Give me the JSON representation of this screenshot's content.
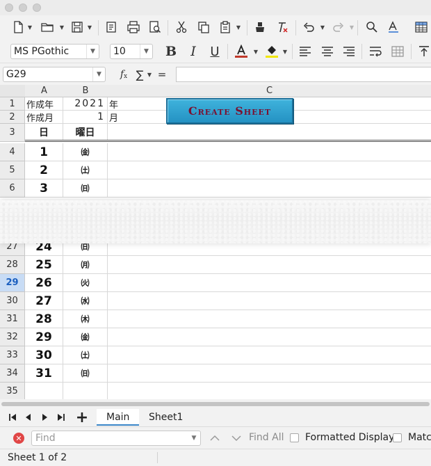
{
  "toolbar": {
    "font_name": "MS PGothic",
    "font_size": "10",
    "font_color": "#c0392b",
    "highlight_color": "#f1e600"
  },
  "formula_bar": {
    "name_box": "G29",
    "fx_symbol": "f",
    "sum_symbol": "∑",
    "equals_symbol": "=",
    "content": ""
  },
  "sheet": {
    "columns": [
      "A",
      "B",
      "C"
    ],
    "selected_row": "29",
    "create_button_label": "Create Sheet",
    "rows_top": [
      {
        "row": "1",
        "a": "作成年",
        "b": "2021",
        "c": "年"
      },
      {
        "row": "2",
        "a": "作成月",
        "b": "1",
        "c": "月"
      },
      {
        "row": "3",
        "a": "日",
        "b": "曜日",
        "c": ""
      }
    ],
    "days_top": [
      {
        "row": "4",
        "day": "1",
        "weekday": "㈮"
      },
      {
        "row": "5",
        "day": "2",
        "weekday": "㈯"
      },
      {
        "row": "6",
        "day": "3",
        "weekday": "㈰"
      }
    ],
    "days_bottom": [
      {
        "row": "27",
        "day": "24",
        "weekday": "㈰"
      },
      {
        "row": "28",
        "day": "25",
        "weekday": "㈪"
      },
      {
        "row": "29",
        "day": "26",
        "weekday": "㈫"
      },
      {
        "row": "30",
        "day": "27",
        "weekday": "㈬"
      },
      {
        "row": "31",
        "day": "28",
        "weekday": "㈭"
      },
      {
        "row": "32",
        "day": "29",
        "weekday": "㈮"
      },
      {
        "row": "33",
        "day": "30",
        "weekday": "㈯"
      },
      {
        "row": "34",
        "day": "31",
        "weekday": "㈰"
      },
      {
        "row": "35",
        "day": "",
        "weekday": ""
      }
    ]
  },
  "tabs": {
    "sheets": [
      "Main",
      "Sheet1"
    ],
    "active": "Main"
  },
  "find": {
    "placeholder": "Find",
    "find_all": "Find All",
    "formatted_display": "Formatted Display",
    "match_case": "Match"
  },
  "status": {
    "sheet_info": "Sheet 1 of 2"
  }
}
